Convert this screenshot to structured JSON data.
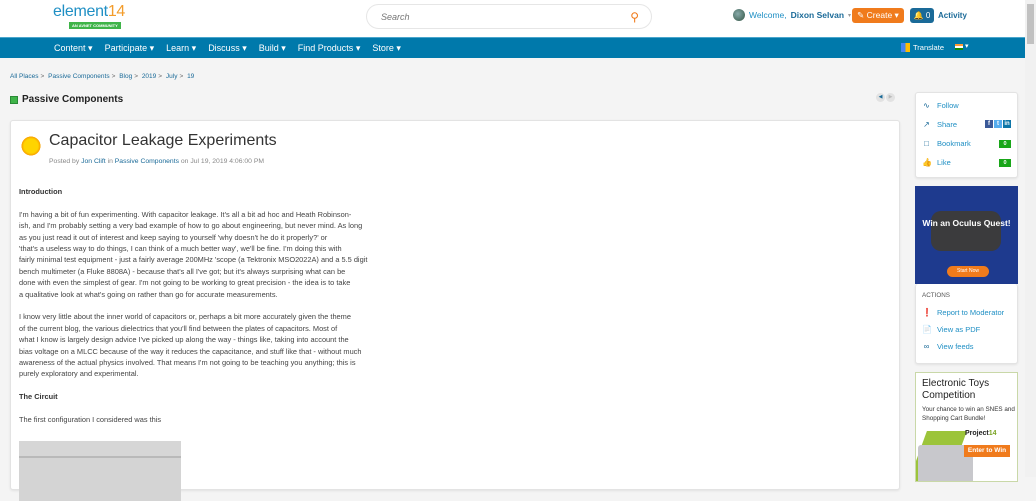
{
  "header": {
    "logo_main": "element",
    "logo_num": "14",
    "logo_tag": "AN AVNET COMMUNITY",
    "search_placeholder": "Search",
    "welcome": "Welcome,",
    "user": "Dixon Selvan",
    "create": "Create",
    "notif_count": "0",
    "activity": "Activity"
  },
  "nav": {
    "items": [
      "Content",
      "Participate",
      "Learn",
      "Discuss",
      "Build",
      "Find Products",
      "Store"
    ],
    "translate": "Translate"
  },
  "breadcrumb": [
    "All Places",
    "Passive Components",
    "Blog",
    "2019",
    "July",
    "19"
  ],
  "section_title": "Passive Components",
  "post": {
    "title": "Capacitor Leakage Experiments",
    "posted_by": "Posted by",
    "author": "Jon Clift",
    "in": "in",
    "place": "Passive Components",
    "date": "on Jul 19, 2019 4:06:00 PM",
    "h_intro": "Introduction",
    "p1": [
      "I'm having a bit of fun experimenting. With capacitor leakage. It's all a bit ad hoc and Heath Robinson-",
      "ish, and I'm probably setting a very bad example of how to go about engineering, but never mind. As long",
      "as you just read it out of interest and keep saying to yourself 'why doesn't he do it properly?' or",
      "'that's a useless way to do things, I can think of a much better way', we'll be fine. I'm doing this with",
      "fairly minimal test equipment - just a fairly average 200MHz 'scope (a Tektronix MSO2022A) and a 5.5 digit",
      "bench multimeter (a Fluke 8808A) - because that's all I've got; but it's always surprising what can be",
      "done with even the simplest of gear. I'm not going to be working to great precision - the idea is to take",
      "a qualitative look at what's going on rather than go for accurate measurements."
    ],
    "p2": [
      "I know very little about the inner world of capacitors or, perhaps a bit more accurately given the theme",
      "of the current blog, the various dielectrics that you'll find between the plates of capacitors. Most of",
      "what I know is largely design advice I've picked up along the way - things like, taking into account the",
      "bias voltage on a MLCC because of the way it reduces the capacitance, and stuff like that - without much",
      "awareness of the actual physics involved. That means I'm not going to be teaching you anything; this is",
      "purely exploratory and experimental."
    ],
    "h_circuit": "The Circuit",
    "p3": "The first configuration I considered was this"
  },
  "sidebar": {
    "follow": "Follow",
    "share": "Share",
    "bookmark": "Bookmark",
    "bookmark_count": "0",
    "like": "Like",
    "like_count": "0",
    "ad1_text": "Win an Oculus Quest!",
    "ad1_button": "Start Now",
    "actions_heading": "ACTIONS",
    "report": "Report to Moderator",
    "pdf": "View as PDF",
    "feeds": "View feeds",
    "ad2_title": "Electronic Toys Competition",
    "ad2_sub": "Your chance to win an SNES and Shopping Cart Bundle!",
    "ad2_brand": "Project",
    "ad2_brand_num": "14",
    "ad2_button": "Enter to Win"
  },
  "colors": {
    "nav": "#0079ab",
    "accent": "#f07b1c",
    "link": "#1f8fc4",
    "count": "#19a619"
  }
}
